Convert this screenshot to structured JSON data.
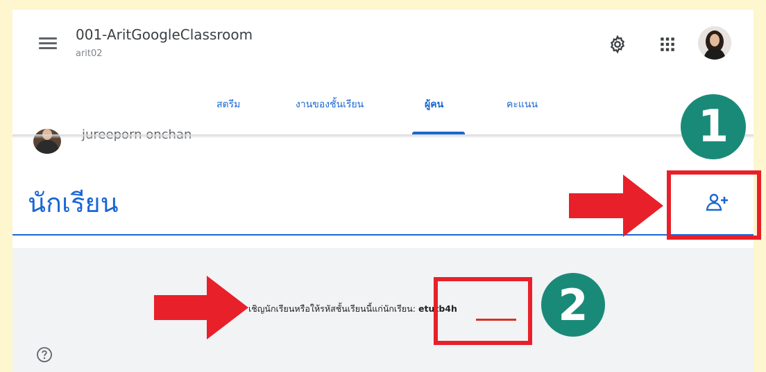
{
  "header": {
    "class_name": "001-AritGoogleClassroom",
    "class_section": "arit02",
    "icons": [
      "menu-icon",
      "gear-icon",
      "apps-grid-icon",
      "account-avatar"
    ]
  },
  "tabs": [
    {
      "label": "สตรีม",
      "active": false
    },
    {
      "label": "งานของชั้นเรียน",
      "active": false
    },
    {
      "label": "ผู้คน",
      "active": true
    },
    {
      "label": "คะแนน",
      "active": false
    }
  ],
  "teacher": {
    "name": "jureeporn onchan"
  },
  "students": {
    "title": "นักเรียน",
    "invite_text": "เชิญนักเรียนหรือให้รหัสชั้นเรียนนี้แก่นักเรียน:",
    "class_code": "etutb4h"
  },
  "annotations": {
    "step1": "1",
    "step2": "2"
  },
  "colors": {
    "accent": "#1967d2",
    "annotation_red": "#e8202a",
    "badge_teal": "#1a8a78",
    "page_bg": "#fdf6cf"
  }
}
